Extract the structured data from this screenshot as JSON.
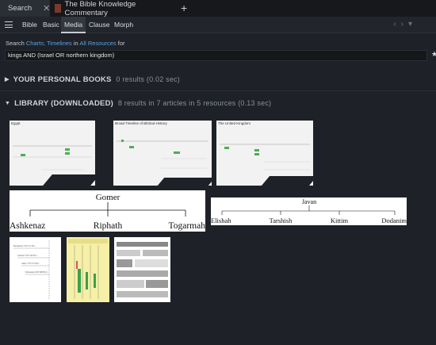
{
  "tabs": [
    {
      "label": "Search",
      "active": true
    },
    {
      "label": "The Bible Knowledge Commentary",
      "active": false
    }
  ],
  "toolbar": {
    "search_types": [
      "Bible",
      "Basic",
      "Media",
      "Clause",
      "Morph"
    ],
    "active_type": "Media"
  },
  "search": {
    "prefix": "Search",
    "types": "Charts; Timelines",
    "mid": "in",
    "scope": "All Resources",
    "suffix": "for",
    "query": "kings  AND (Israel OR northern kingdom)"
  },
  "sections": {
    "personal": {
      "title": "YOUR PERSONAL BOOKS",
      "meta": "0 results (0.02 sec)"
    },
    "library": {
      "title": "LIBRARY (DOWNLOADED)",
      "meta": "8 results in 7 articles in 5 resources (0.13 sec)"
    }
  },
  "results": {
    "thumb1_title": "Egypt",
    "thumb2_title": "Broad Timeline of Biblical History",
    "thumb3_title": "The United Kingdom",
    "gomer": {
      "root": "Gomer",
      "children": [
        "Ashkenaz",
        "Riphath",
        "Togarmah"
      ]
    },
    "javan": {
      "root": "Javan",
      "children": [
        "Elishah",
        "Tarshish",
        "Kittim",
        "Dodanim"
      ]
    },
    "small1_labels": [
      "Hezekiah 716/715 B.C.",
      "Jotham 750/740 B.C.",
      "Ahaz 735/731 B.C.",
      "Manasseh 697/686 B.C."
    ]
  }
}
